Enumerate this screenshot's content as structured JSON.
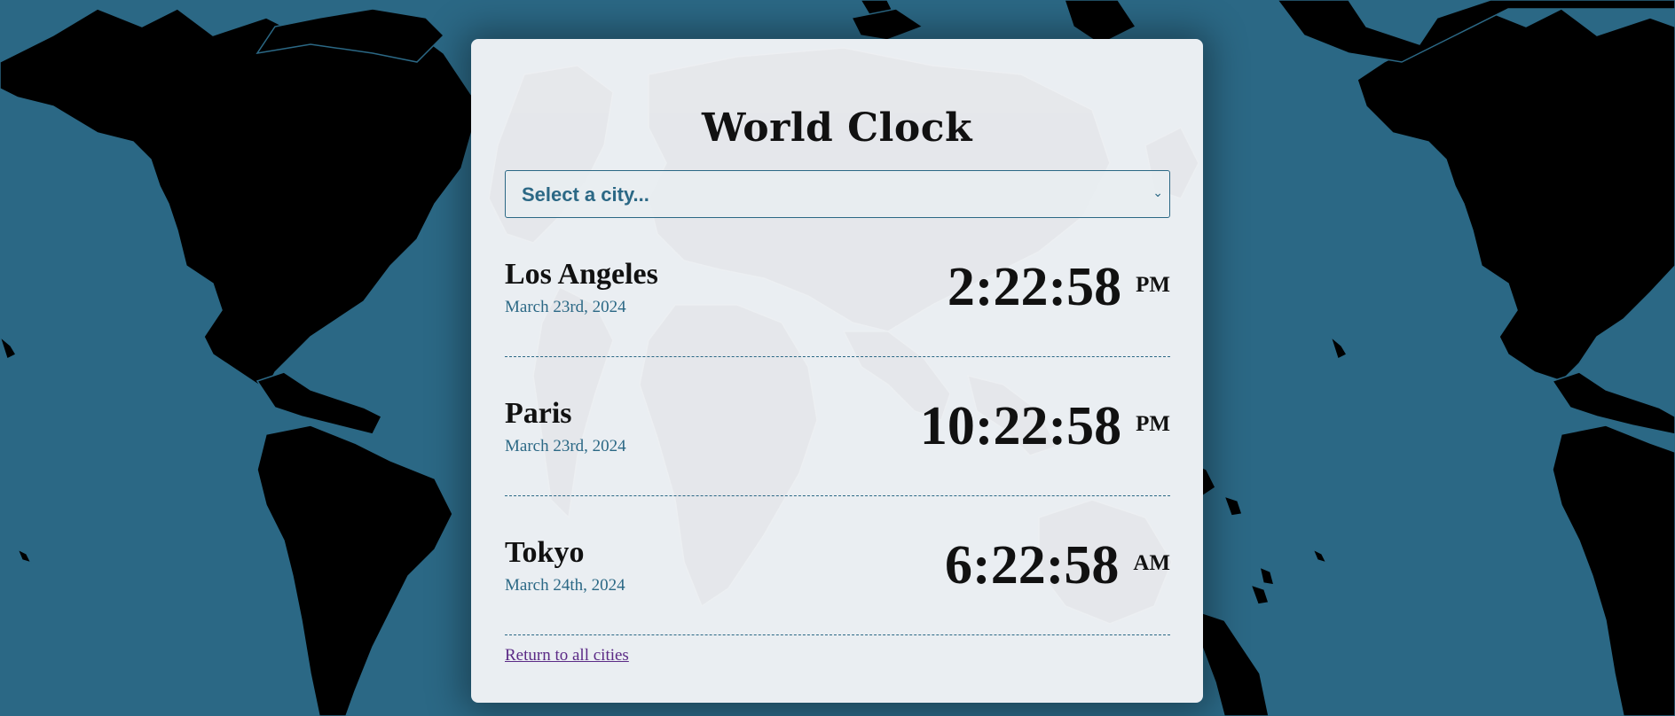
{
  "app": {
    "title": "World Clock"
  },
  "city_select": {
    "placeholder_option": "Select a city..."
  },
  "clocks": [
    {
      "city": "Los Angeles",
      "date": "March 23rd, 2024",
      "time": "2:22:58",
      "period": "PM"
    },
    {
      "city": "Paris",
      "date": "March 23rd, 2024",
      "time": "10:22:58",
      "period": "PM"
    },
    {
      "city": "Tokyo",
      "date": "March 24th, 2024",
      "time": "6:22:58",
      "period": "AM"
    }
  ],
  "footer": {
    "return_link": "Return to all cities"
  },
  "colors": {
    "background": "#2b6885",
    "card": "#eaeef2",
    "accent": "#2b6885",
    "link_visited": "#5b2a86",
    "land": "#000000"
  },
  "icons": {
    "select_arrow": "chevron-down-icon"
  }
}
